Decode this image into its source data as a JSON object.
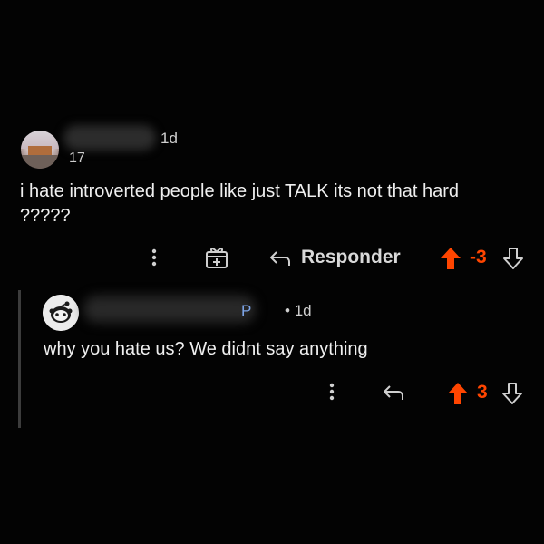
{
  "colors": {
    "background": "#030303",
    "text": "#efefef",
    "muted": "#cfcfcf",
    "upvote_accent": "#ff4500",
    "username_link": "#7ea6ea"
  },
  "comment_1": {
    "avatar_icon": "user-avatar-photo",
    "timestamp": "1d",
    "karma": "17",
    "body": "i hate introverted people like just TALK its not that hard ?????",
    "actions": {
      "more_icon": "more-vertical-icon",
      "award_icon": "gift-award-icon",
      "reply_icon": "reply-arrow-icon",
      "reply_label": "Responder",
      "upvote_icon": "upvote-arrow-icon",
      "score": "-3",
      "downvote_icon": "downvote-arrow-icon"
    }
  },
  "comment_2": {
    "avatar_icon": "user-avatar-snoo",
    "username_tail": "P",
    "separator": "•",
    "timestamp": "1d",
    "body": "why you hate us? We didnt say anything",
    "actions": {
      "more_icon": "more-vertical-icon",
      "reply_icon": "reply-arrow-icon",
      "upvote_icon": "upvote-arrow-icon",
      "score": "3",
      "downvote_icon": "downvote-arrow-icon"
    }
  }
}
